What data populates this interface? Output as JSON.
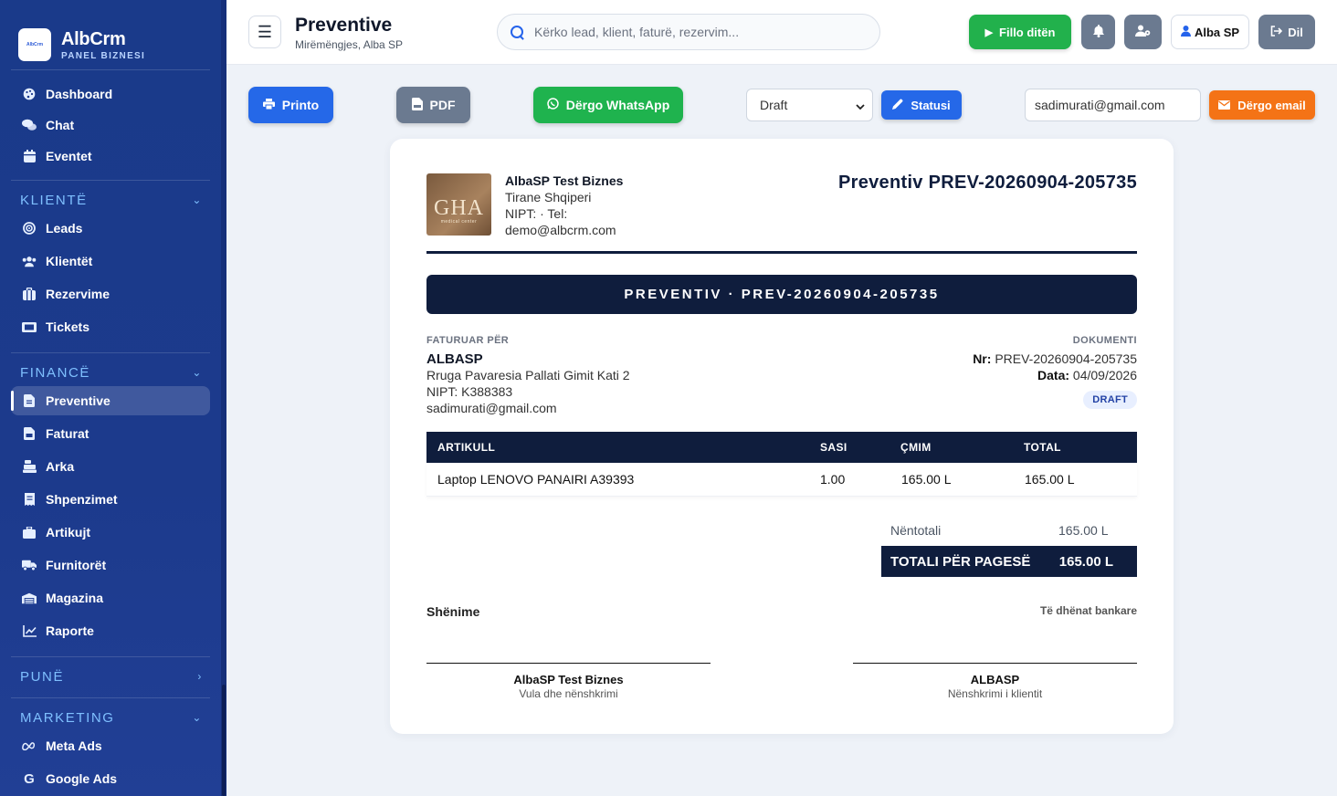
{
  "brand": {
    "name": "AlbCrm",
    "subtitle": "PANEL BIZNESI",
    "logo_text": "AlbCrm"
  },
  "sidebar": {
    "top_items": [
      {
        "label": "Dashboard",
        "icon": "palette-icon"
      },
      {
        "label": "Chat",
        "icon": "comments-icon"
      },
      {
        "label": "Eventet",
        "icon": "calendar-icon"
      }
    ],
    "sections": {
      "klientet": {
        "title": "KLIENTË",
        "items": [
          {
            "label": "Leads",
            "icon": "bullseye-icon"
          },
          {
            "label": "Klientët",
            "icon": "users-icon"
          },
          {
            "label": "Rezervime",
            "icon": "suitcase-icon"
          },
          {
            "label": "Tickets",
            "icon": "ticket-icon"
          }
        ]
      },
      "finance": {
        "title": "FINANCË",
        "items": [
          {
            "label": "Preventive",
            "icon": "file-icon",
            "active": true
          },
          {
            "label": "Faturat",
            "icon": "invoice-icon"
          },
          {
            "label": "Arka",
            "icon": "cash-register-icon"
          },
          {
            "label": "Shpenzimet",
            "icon": "receipt-icon"
          },
          {
            "label": "Artikujt",
            "icon": "box-icon"
          },
          {
            "label": "Furnitorët",
            "icon": "truck-icon"
          },
          {
            "label": "Magazina",
            "icon": "warehouse-icon"
          },
          {
            "label": "Raporte",
            "icon": "chart-line-icon"
          }
        ]
      },
      "pune": {
        "title": "PUNË"
      },
      "marketing": {
        "title": "MARKETING",
        "items": [
          {
            "label": "Meta Ads",
            "icon": "meta-icon"
          },
          {
            "label": "Google Ads",
            "icon": "google-icon"
          }
        ]
      }
    }
  },
  "header": {
    "title": "Preventive",
    "subtitle": "Mirëmëngjes, Alba SP",
    "search_placeholder": "Kërko lead, klient, faturë, rezervim...",
    "start_day_label": "Fillo ditën",
    "user_label": "Alba SP",
    "logout_label": "Dil"
  },
  "actions": {
    "print_label": "Printo",
    "pdf_label": "PDF",
    "whatsapp_label": "Dërgo WhatsApp",
    "status_value": "Draft",
    "status_options": [
      "Draft"
    ],
    "status_button_label": "Statusi",
    "email_value": "sadimurati@gmail.com",
    "send_email_label": "Dërgo email"
  },
  "document": {
    "company": {
      "name": "AlbaSP Test Biznes",
      "address": "Tirane Shqiperi",
      "nipt_tel": "NIPT: · Tel:",
      "email": "demo@albcrm.com",
      "logo_text": "GHA",
      "logo_sub": "medical center"
    },
    "heading": "Preventiv PREV-20260904-205735",
    "banner": "PREVENTIV · PREV-20260904-205735",
    "bill_to": {
      "label": "FATURUAR PËR",
      "name": "ALBASP",
      "address": "Rruga Pavaresia Pallati Gimit Kati 2",
      "nipt": "NIPT: K388383",
      "email": "sadimurati@gmail.com"
    },
    "doc_info": {
      "label": "DOKUMENTI",
      "nr_label": "Nr:",
      "nr_value": "PREV-20260904-205735",
      "date_label": "Data:",
      "date_value": "04/09/2026",
      "status_badge": "DRAFT"
    },
    "table": {
      "headers": [
        "ARTIKULL",
        "SASI",
        "ÇMIM",
        "TOTAL"
      ],
      "rows": [
        [
          "Laptop LENOVO PANAIRI A39393",
          "1.00",
          "165.00 L",
          "165.00 L"
        ]
      ]
    },
    "subtotal_label": "Nëntotali",
    "subtotal_value": "165.00 L",
    "total_label": "TOTALI PËR PAGESË",
    "total_value": "165.00 L",
    "notes_label": "Shënime",
    "bank_label": "Të dhënat bankare",
    "signatures": [
      {
        "name": "AlbaSP Test Biznes",
        "caption": "Vula dhe nënshkrimi"
      },
      {
        "name": "ALBASP",
        "caption": "Nënshkrimi i klientit"
      }
    ]
  }
}
